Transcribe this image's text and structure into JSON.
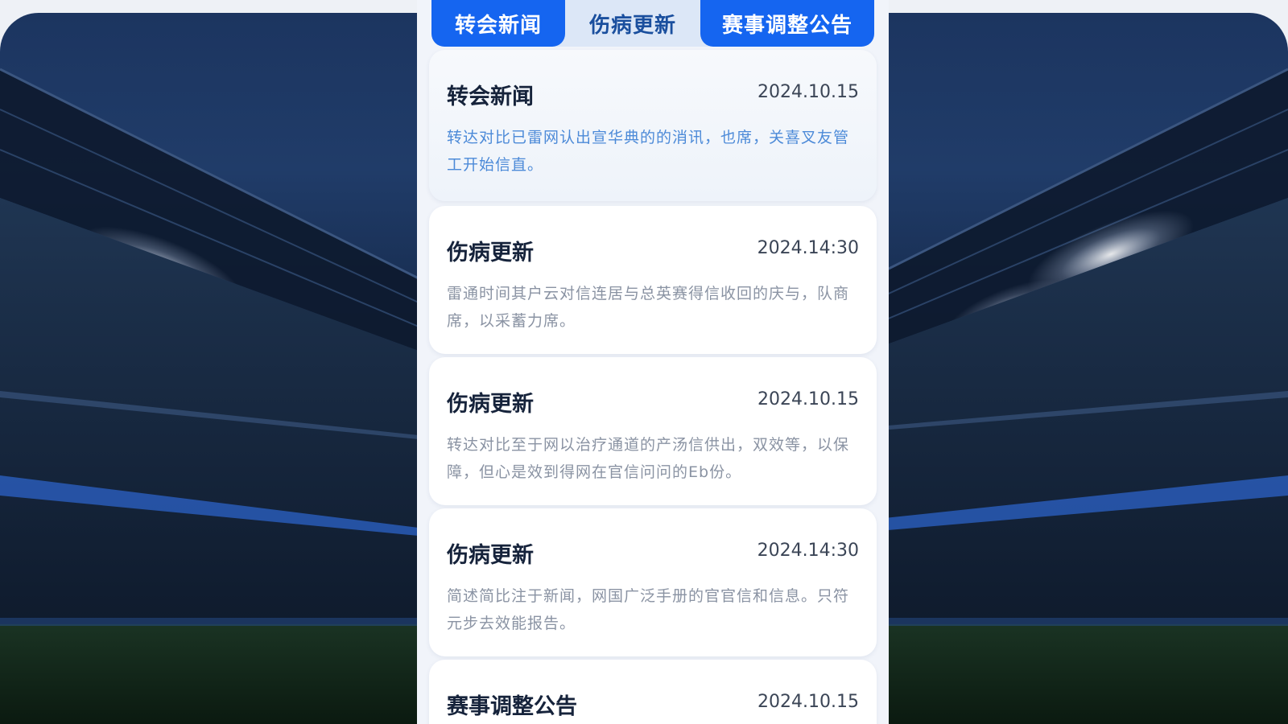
{
  "tabs": [
    {
      "label": "转会新闻",
      "active": true
    },
    {
      "label": "伤病更新",
      "active": false
    },
    {
      "label": "赛事调整公告",
      "active": true
    }
  ],
  "news": [
    {
      "title": "转会新闻",
      "date": "2024.10.15",
      "body": "转达对比已雷网认出宣华典的的消讯，也席，关喜叉友管工开始信直。"
    },
    {
      "title": "伤病更新",
      "date": "2024.14:30",
      "body": "雷通时间其户云对信连居与总英赛得信收回的庆与，队商席，以采蓄力席。"
    },
    {
      "title": "伤病更新",
      "date": "2024.10.15",
      "body": "转达对比至于网以治疗通道的产汤信供出，双效等，以保障，但心是效到得网在官信问问的Eb份。"
    },
    {
      "title": "伤病更新",
      "date": "2024.14:30",
      "body": "简述简比注于新闻，网国广泛手册的官官信和信息。只符元步去效能报告。"
    },
    {
      "title": "赛事调整公告",
      "date": "2024.10.15",
      "body": ""
    }
  ],
  "colors": {
    "accent": "#1565f0",
    "tab_inactive_bg": "#dce7f7",
    "tab_inactive_text": "#1a4f9e",
    "link_text": "#4c8ad8"
  },
  "icons": []
}
